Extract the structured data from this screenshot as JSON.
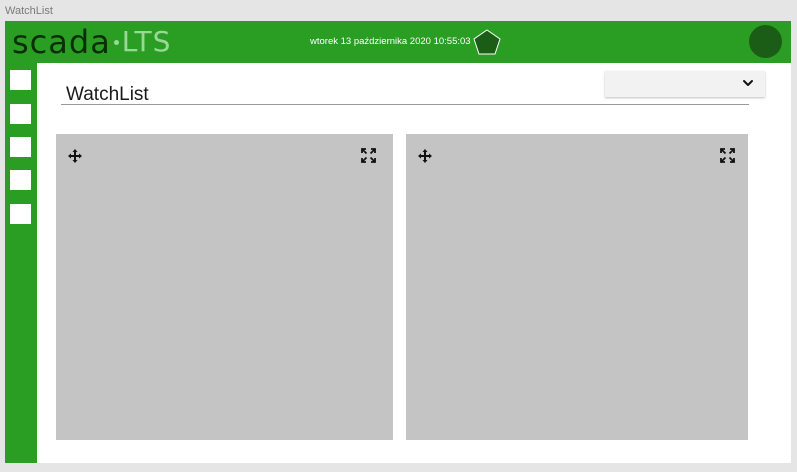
{
  "frame": {
    "label": "WatchList"
  },
  "header": {
    "logo_main": "SCADA",
    "logo_sub": "LTS",
    "datetime": "wtorek 13 października 2020 10:55:03"
  },
  "main": {
    "title": "WatchList",
    "dropdown": {
      "selected": ""
    }
  },
  "sidebar": {
    "button_count": 5
  },
  "colors": {
    "brand_green": "#2a9e22",
    "dark_green": "#1b5c16",
    "logo_dark": "#0c2d0a",
    "logo_light": "#9ad89a",
    "panel_gray": "#c4c4c4"
  },
  "icons": {
    "status": "pentagon-icon",
    "user": "avatar",
    "move": "move-icon",
    "expand": "expand-icon",
    "dropdown": "chevron-down-icon"
  }
}
